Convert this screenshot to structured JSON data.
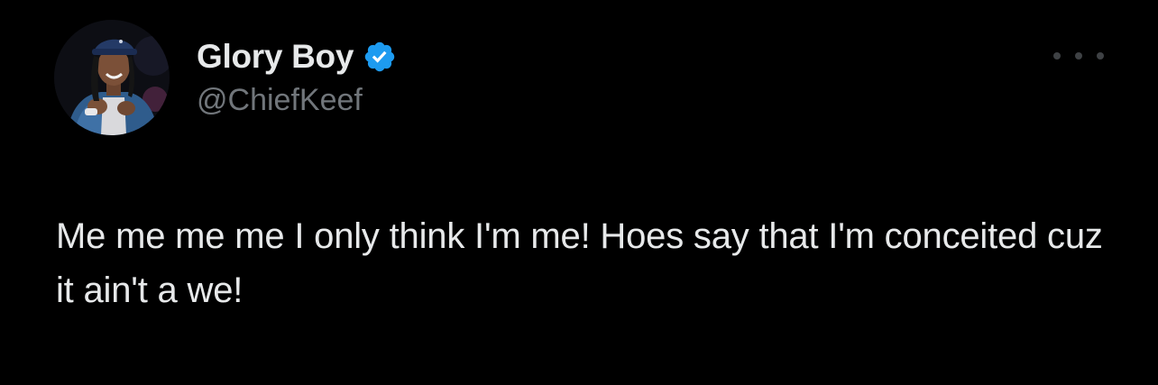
{
  "author": {
    "display_name": "Glory Boy",
    "handle": "@ChiefKeef",
    "verified": true
  },
  "tweet": {
    "text": "Me me me me I only think I'm me! Hoes say that I'm conceited cuz it ain't a we!"
  },
  "icons": {
    "avatar": "avatar-photo",
    "verified": "verified-badge-icon",
    "more": "more-options-icon"
  },
  "colors": {
    "background": "#000000",
    "primary_text": "#e7e9ea",
    "secondary_text": "#71767b",
    "verified_badge": "#1d9bf0"
  }
}
